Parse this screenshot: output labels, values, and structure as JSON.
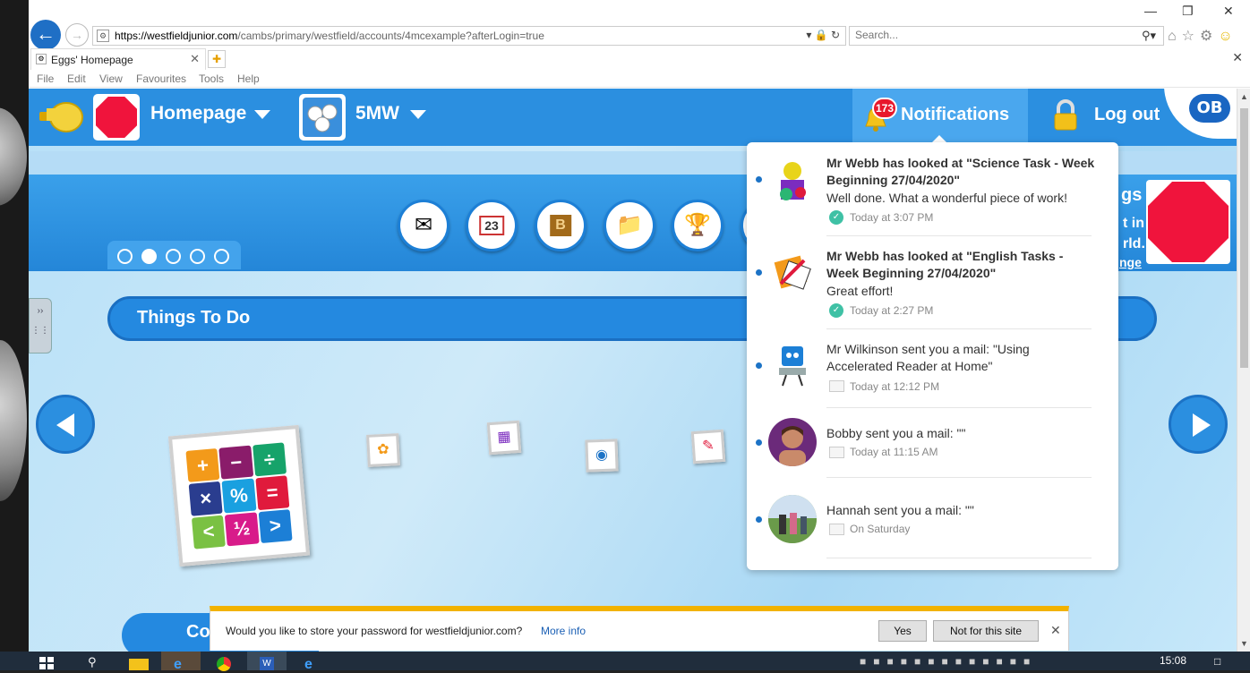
{
  "browser": {
    "url_domain": "https://westfieldjunior.com",
    "url_path": "/cambs/primary/westfield/accounts/4mcexample?afterLogin=true",
    "search_placeholder": "Search...",
    "tab_title": "Eggs' Homepage",
    "menu": [
      "File",
      "Edit",
      "View",
      "Favourites",
      "Tools",
      "Help"
    ]
  },
  "header": {
    "home_label": "Homepage",
    "class_label": "5MW",
    "notifications_label": "Notifications",
    "notification_count": "173",
    "logout_label": "Log out",
    "brand_logo_text": "OB"
  },
  "profile": {
    "text_lines": [
      "gs",
      "t in",
      "rld.",
      "nge"
    ]
  },
  "carousel": {
    "pages": 5,
    "active_page": 2
  },
  "things_to_do": {
    "title": "Things To Do",
    "maths_tiles": [
      "+",
      "−",
      "÷",
      "×",
      "%",
      "=",
      "<",
      "½",
      ">"
    ]
  },
  "second_section": {
    "title_fragment": "Co"
  },
  "notifications": [
    {
      "title": "Mr Webb has looked at \"Science Task - Week Beginning 27/04/2020\"",
      "body": "Well done. What a wonderful piece of work!",
      "time": "Today at 3:07 PM",
      "kind": "tick"
    },
    {
      "title": "Mr Webb has looked at \"English Tasks - Week Beginning 27/04/2020\"",
      "body": "Great effort!",
      "time": "Today at 2:27 PM",
      "kind": "tick"
    },
    {
      "title": "Mr Wilkinson sent you a mail: \"Using Accelerated Reader at Home\"",
      "body": "",
      "time": "Today at 12:12 PM",
      "kind": "mail"
    },
    {
      "title": "Bobby sent you a mail: \"\"",
      "body": "",
      "time": "Today at 11:15 AM",
      "kind": "mail"
    },
    {
      "title": "Hannah sent you a mail: \"\"",
      "body": "",
      "time": "On Saturday",
      "kind": "mail"
    }
  ],
  "password_prompt": {
    "text": "Would you like to store your password for westfieldjunior.com?",
    "more_info": "More info",
    "yes": "Yes",
    "not_for_site": "Not for this site"
  },
  "taskbar": {
    "clock": "15:08",
    "left_fragment": "08"
  },
  "colors": {
    "brand_blue": "#2b8fe0",
    "notif_tab": "#4aa7ee",
    "badge_red": "#e8182b",
    "avatar_red": "#f0143c",
    "prompt_accent": "#f2b200"
  }
}
